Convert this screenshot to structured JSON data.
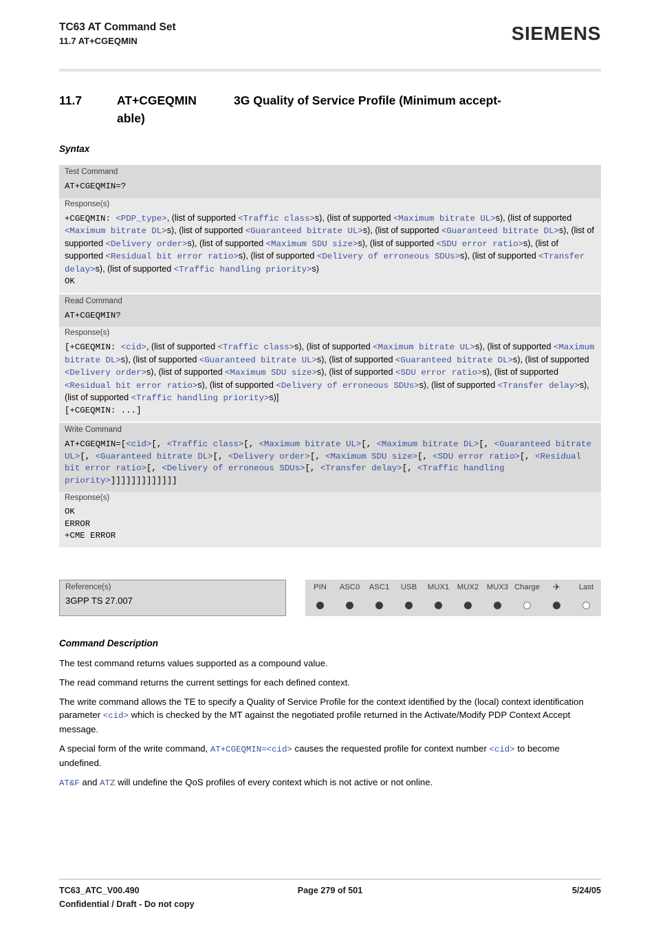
{
  "header": {
    "title": "TC63 AT Command Set",
    "subtitle": "11.7 AT+CGEQMIN",
    "logo": "SIEMENS"
  },
  "section": {
    "number": "11.7",
    "command": "AT+CGEQMIN",
    "title_line1": "3G Quality of Service Profile (Minimum accept-",
    "title_line2": "able)"
  },
  "syntax_label": "Syntax",
  "blocks": {
    "test": {
      "label": "Test Command",
      "command": "AT+CGEQMIN=?",
      "response_label": "Response(s)",
      "response_line1_pre": "+CGEQMIN: ",
      "response_body": "+CGEQMIN: <PDP_type>, (list of supported <Traffic class>s), (list of supported <Maximum bitrate UL>s), (list of supported <Maximum bitrate DL>s), (list of supported <Guaranteed bitrate UL>s), (list of supported <Guaranteed bitrate DL>s), (list of supported <Delivery order>s), (list of supported <Maximum SDU size>s), (list of supported <SDU error ratio>s), (list of supported <Residual bit error ratio>s), (list of supported <Delivery of erroneous SDUs>s), (list of supported <Transfer delay>s), (list of supported <Traffic handling priority>s)",
      "response_ok": "OK"
    },
    "read": {
      "label": "Read Command",
      "command": "AT+CGEQMIN?",
      "response_label": "Response(s)",
      "response_body": "[+CGEQMIN: <cid>, (list of supported <Traffic class>s), (list of supported <Maximum bitrate UL>s), (list of supported <Maximum bitrate DL>s), (list of supported <Guaranteed bitrate UL>s), (list of supported <Guaranteed bitrate DL>s), (list of supported <Delivery order>s), (list of supported <Maximum SDU size>s), (list of supported <SDU error ratio>s), (list of supported <Residual bit error ratio>s), (list of supported <Delivery of erroneous SDUs>s), (list of supported <Transfer delay>s), (list of supported <Traffic handling priority>s)]",
      "response_more": "[+CGEQMIN: ...]"
    },
    "write": {
      "label": "Write Command",
      "command": "AT+CGEQMIN=[<cid>[, <Traffic class>[, <Maximum bitrate UL>[, <Maximum bitrate DL>[, <Guaranteed bitrate UL>[, <Guaranteed bitrate DL>[, <Delivery order>[, <Maximum SDU size>[, <SDU error ratio>[, <Residual bit error ratio>[, <Delivery of erroneous SDUs>[, <Transfer delay>[, <Traffic handling priority>]]]]]]]]]]]]]",
      "response_label": "Response(s)",
      "responses": [
        "OK",
        "ERROR",
        "+CME ERROR"
      ]
    }
  },
  "reference": {
    "label": "Reference(s)",
    "value": "3GPP TS 27.007"
  },
  "pin_table": {
    "columns": [
      {
        "header": "PIN",
        "state": "filled"
      },
      {
        "header": "ASC0",
        "state": "filled"
      },
      {
        "header": "ASC1",
        "state": "filled"
      },
      {
        "header": "USB",
        "state": "filled"
      },
      {
        "header": "MUX1",
        "state": "filled"
      },
      {
        "header": "MUX2",
        "state": "filled"
      },
      {
        "header": "MUX3",
        "state": "filled"
      },
      {
        "header": "Charge",
        "state": "open"
      },
      {
        "header": "✈",
        "state": "filled"
      },
      {
        "header": "Last",
        "state": "open"
      }
    ]
  },
  "command_description": {
    "heading": "Command Description",
    "paragraphs": [
      "The test command returns values supported as a compound value.",
      "The read command returns the current settings for each defined context.",
      "The write command allows the TE to specify a Quality of Service Profile for the context identified by the (local) context identification parameter <cid> which is checked by the MT against the negotiated profile returned in the Activate/Modify PDP Context Accept message.",
      "A special form of the write command, AT+CGEQMIN=<cid> causes the requested profile for context number <cid> to become undefined.",
      "AT&F and ATZ will undefine the QoS profiles of every context which is not active or not online."
    ]
  },
  "footer": {
    "doc_id": "TC63_ATC_V00.490",
    "page": "Page 279 of 501",
    "date": "5/24/05",
    "confidential": "Confidential / Draft - Do not copy"
  }
}
